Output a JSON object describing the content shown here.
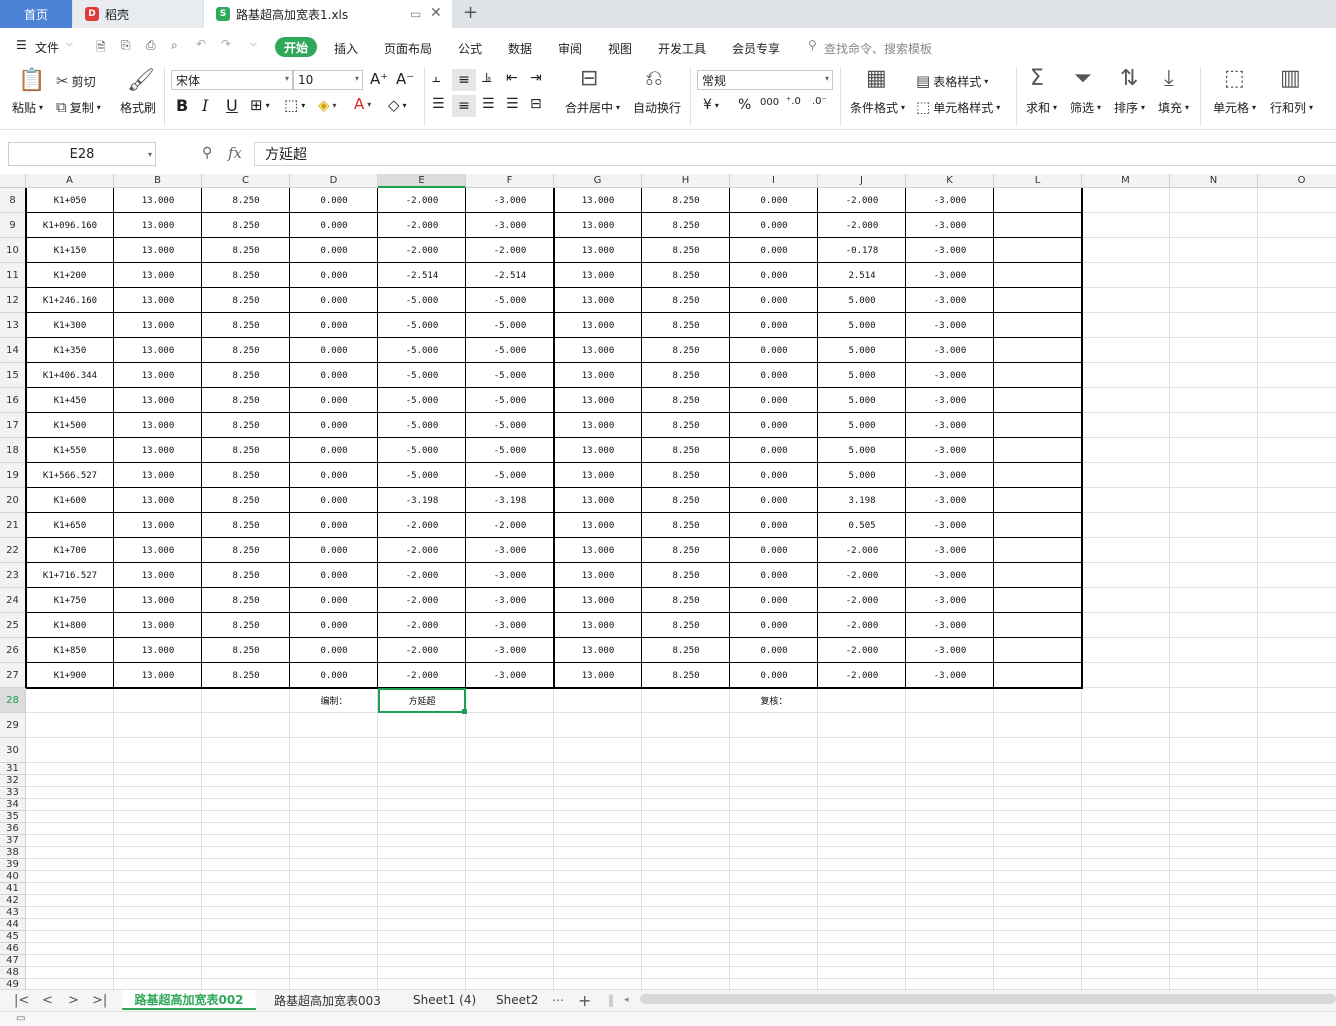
{
  "tabs": {
    "home": "首页",
    "daoke": "稻壳",
    "file": "路基超高加宽表1.xls"
  },
  "menu": {
    "file": "文件",
    "start": "开始",
    "insert": "插入",
    "layout": "页面布局",
    "formula": "公式",
    "data": "数据",
    "review": "审阅",
    "view": "视图",
    "dev": "开发工具",
    "vip": "会员专享",
    "search": "查找命令、搜索模板"
  },
  "ribbon": {
    "paste": "粘贴",
    "cut": "剪切",
    "copy": "复制",
    "format_painter": "格式刷",
    "font": "宋体",
    "font_size": "10",
    "merge": "合并居中",
    "wrap": "自动换行",
    "number_format": "常规",
    "cond_format": "条件格式",
    "table_style": "表格样式",
    "cell_style": "单元格样式",
    "sum": "求和",
    "filter": "筛选",
    "sort": "排序",
    "fill": "填充",
    "cell": "单元格",
    "rowcol": "行和列",
    "currency": "¥",
    "percent": "%",
    "thousands": "000"
  },
  "formula": {
    "name_box": "E28",
    "fx": "fx",
    "value": "方延超"
  },
  "columns": [
    "A",
    "B",
    "C",
    "D",
    "E",
    "F",
    "G",
    "H",
    "I",
    "J",
    "K",
    "L",
    "M",
    "N",
    "O"
  ],
  "rows": [
    [
      "8",
      "K1+050",
      "13.000",
      "8.250",
      "0.000",
      "-2.000",
      "-3.000",
      "13.000",
      "8.250",
      "0.000",
      "-2.000",
      "-3.000"
    ],
    [
      "9",
      "K1+096.160",
      "13.000",
      "8.250",
      "0.000",
      "-2.000",
      "-3.000",
      "13.000",
      "8.250",
      "0.000",
      "-2.000",
      "-3.000"
    ],
    [
      "10",
      "K1+150",
      "13.000",
      "8.250",
      "0.000",
      "-2.000",
      "-2.000",
      "13.000",
      "8.250",
      "0.000",
      "-0.178",
      "-3.000"
    ],
    [
      "11",
      "K1+200",
      "13.000",
      "8.250",
      "0.000",
      "-2.514",
      "-2.514",
      "13.000",
      "8.250",
      "0.000",
      "2.514",
      "-3.000"
    ],
    [
      "12",
      "K1+246.160",
      "13.000",
      "8.250",
      "0.000",
      "-5.000",
      "-5.000",
      "13.000",
      "8.250",
      "0.000",
      "5.000",
      "-3.000"
    ],
    [
      "13",
      "K1+300",
      "13.000",
      "8.250",
      "0.000",
      "-5.000",
      "-5.000",
      "13.000",
      "8.250",
      "0.000",
      "5.000",
      "-3.000"
    ],
    [
      "14",
      "K1+350",
      "13.000",
      "8.250",
      "0.000",
      "-5.000",
      "-5.000",
      "13.000",
      "8.250",
      "0.000",
      "5.000",
      "-3.000"
    ],
    [
      "15",
      "K1+406.344",
      "13.000",
      "8.250",
      "0.000",
      "-5.000",
      "-5.000",
      "13.000",
      "8.250",
      "0.000",
      "5.000",
      "-3.000"
    ],
    [
      "16",
      "K1+450",
      "13.000",
      "8.250",
      "0.000",
      "-5.000",
      "-5.000",
      "13.000",
      "8.250",
      "0.000",
      "5.000",
      "-3.000"
    ],
    [
      "17",
      "K1+500",
      "13.000",
      "8.250",
      "0.000",
      "-5.000",
      "-5.000",
      "13.000",
      "8.250",
      "0.000",
      "5.000",
      "-3.000"
    ],
    [
      "18",
      "K1+550",
      "13.000",
      "8.250",
      "0.000",
      "-5.000",
      "-5.000",
      "13.000",
      "8.250",
      "0.000",
      "5.000",
      "-3.000"
    ],
    [
      "19",
      "K1+566.527",
      "13.000",
      "8.250",
      "0.000",
      "-5.000",
      "-5.000",
      "13.000",
      "8.250",
      "0.000",
      "5.000",
      "-3.000"
    ],
    [
      "20",
      "K1+600",
      "13.000",
      "8.250",
      "0.000",
      "-3.198",
      "-3.198",
      "13.000",
      "8.250",
      "0.000",
      "3.198",
      "-3.000"
    ],
    [
      "21",
      "K1+650",
      "13.000",
      "8.250",
      "0.000",
      "-2.000",
      "-2.000",
      "13.000",
      "8.250",
      "0.000",
      "0.505",
      "-3.000"
    ],
    [
      "22",
      "K1+700",
      "13.000",
      "8.250",
      "0.000",
      "-2.000",
      "-3.000",
      "13.000",
      "8.250",
      "0.000",
      "-2.000",
      "-3.000"
    ],
    [
      "23",
      "K1+716.527",
      "13.000",
      "8.250",
      "0.000",
      "-2.000",
      "-3.000",
      "13.000",
      "8.250",
      "0.000",
      "-2.000",
      "-3.000"
    ],
    [
      "24",
      "K1+750",
      "13.000",
      "8.250",
      "0.000",
      "-2.000",
      "-3.000",
      "13.000",
      "8.250",
      "0.000",
      "-2.000",
      "-3.000"
    ],
    [
      "25",
      "K1+800",
      "13.000",
      "8.250",
      "0.000",
      "-2.000",
      "-3.000",
      "13.000",
      "8.250",
      "0.000",
      "-2.000",
      "-3.000"
    ],
    [
      "26",
      "K1+850",
      "13.000",
      "8.250",
      "0.000",
      "-2.000",
      "-3.000",
      "13.000",
      "8.250",
      "0.000",
      "-2.000",
      "-3.000"
    ],
    [
      "27",
      "K1+900",
      "13.000",
      "8.250",
      "0.000",
      "-2.000",
      "-3.000",
      "13.000",
      "8.250",
      "0.000",
      "-2.000",
      "-3.000"
    ]
  ],
  "row28": {
    "num": "28",
    "d": "编制：",
    "e": "方延超",
    "i": "复核："
  },
  "empty_rows": [
    "29",
    "30",
    "31",
    "32",
    "33",
    "34",
    "35",
    "36",
    "37",
    "38",
    "39",
    "40",
    "41",
    "42",
    "43",
    "44",
    "45",
    "46",
    "47",
    "48",
    "49"
  ],
  "sheets": [
    "路基超高加宽表002",
    "路基超高加宽表003",
    "Sheet1 (4)",
    "Sheet2"
  ],
  "colors": {
    "accent": "#2fa85a",
    "home_tab": "#4c83d6",
    "selection": "#1e9e50"
  }
}
